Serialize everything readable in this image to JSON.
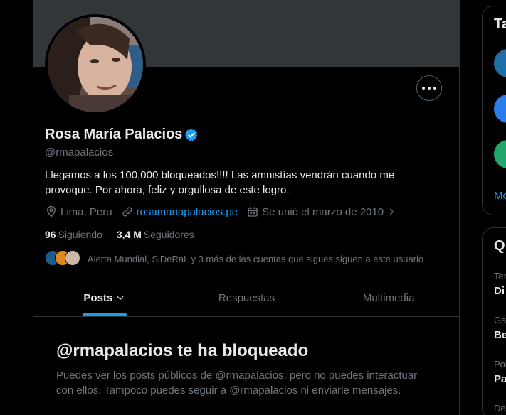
{
  "profile": {
    "name": "Rosa María Palacios",
    "handle": "@rmapalacios",
    "bio": "Llegamos a los 100,000  bloqueados!!!! Las amnistías vendrán cuando me provoque. Por ahora, feliz y orgullosa de este logro.",
    "location": "Lima, Peru",
    "website": "rosamariapalacios.pe",
    "joined": "Se unió el marzo de 2010",
    "following_count": "96",
    "following_label": "Siguiendo",
    "followers_count": "3,4 M",
    "followers_label": "Seguidores",
    "followers_you_know": "Alerta Mundial, SiDeRaL y 3 más de las cuentas que sigues siguen a este usuario"
  },
  "tabs": [
    {
      "label": "Posts",
      "active": true
    },
    {
      "label": "Respuestas",
      "active": false
    },
    {
      "label": "Multimedia",
      "active": false
    }
  ],
  "blocked": {
    "title": "@rmapalacios te ha bloqueado",
    "description": "Puedes ver los posts públicos de @rmapalacios, pero no puedes interactuar con ellos. Tampoco puedes seguir a @rmapalacios ni enviarle mensajes."
  },
  "sidebar": {
    "card1_title": "Ta",
    "card1_more": "Mo",
    "card2_title": "Q",
    "items": [
      {
        "sub": "Ten",
        "main": "Di"
      },
      {
        "sub": "Ga",
        "main": "Be"
      },
      {
        "sub": "Pol",
        "main": "Pa"
      },
      {
        "sub": "De",
        "main": ""
      }
    ]
  },
  "colors": {
    "accent": "#1d9bf0",
    "verified": "#1d9bf0",
    "background": "#000000",
    "banner": "#333639"
  }
}
